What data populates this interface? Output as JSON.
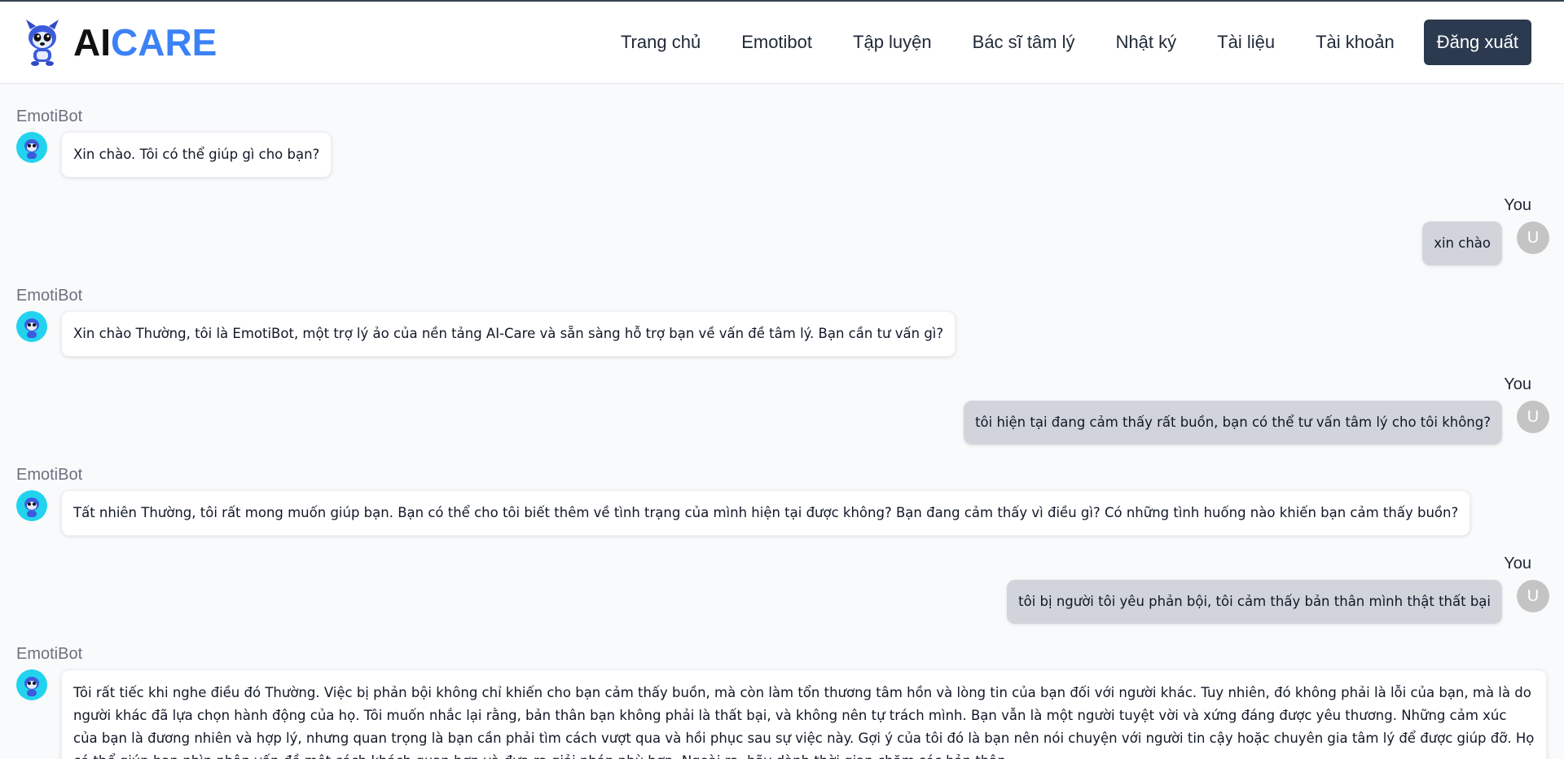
{
  "brand": {
    "ai": "AI",
    "care": "CARE"
  },
  "nav": {
    "items": [
      "Trang chủ",
      "Emotibot",
      "Tập luyện",
      "Bác sĩ tâm lý",
      "Nhật ký",
      "Tài liệu",
      "Tài khoản"
    ],
    "logout": "Đăng xuất"
  },
  "chat": {
    "bot_name": "EmotiBot",
    "user_name": "You",
    "user_initial": "U",
    "messages": [
      {
        "from": "bot",
        "text": "Xin chào. Tôi có thể giúp gì cho bạn?"
      },
      {
        "from": "user",
        "text": "xin chào"
      },
      {
        "from": "bot",
        "text": "Xin chào Thường, tôi là EmotiBot, một trợ lý ảo của nền tảng AI-Care và sẵn sàng hỗ trợ bạn về vấn đề tâm lý. Bạn cần tư vấn gì?"
      },
      {
        "from": "user",
        "text": "tôi hiện tại đang cảm thấy rất buồn, bạn có thể tư vấn tâm lý cho tôi không?"
      },
      {
        "from": "bot",
        "text": "Tất nhiên Thường, tôi rất mong muốn giúp bạn. Bạn có thể cho tôi biết thêm về tình trạng của mình hiện tại được không? Bạn đang cảm thấy vì điều gì? Có những tình huống nào khiến bạn cảm thấy buồn?"
      },
      {
        "from": "user",
        "text": "tôi bị người tôi yêu phản bội, tôi cảm thấy bản thân mình thật thất bại"
      },
      {
        "from": "bot",
        "text": "Tôi rất tiếc khi nghe điều đó Thường. Việc bị phản bội không chỉ khiến cho bạn cảm thấy buồn, mà còn làm tổn thương tâm hồn và lòng tin của bạn đối với người khác. Tuy nhiên, đó không phải là lỗi của bạn, mà là do người khác đã lựa chọn hành động của họ. Tôi muốn nhắc lại rằng, bản thân bạn không phải là thất bại, và không nên tự trách mình. Bạn vẫn là một người tuyệt vời và xứng đáng được yêu thương. Những cảm xúc của bạn là đương nhiên và hợp lý, nhưng quan trọng là bạn cần phải tìm cách vượt qua và hồi phục sau sự việc này. Gợi ý của tôi đó là bạn nên nói chuyện với người tin cậy hoặc chuyên gia tâm lý để được giúp đỡ. Họ có thể giúp bạn nhìn nhận vấn đề một cách khách quan hơn và đưa ra giải pháp phù hợp. Ngoài ra, hãy dành thời gian chăm sóc bản thân."
      }
    ]
  }
}
